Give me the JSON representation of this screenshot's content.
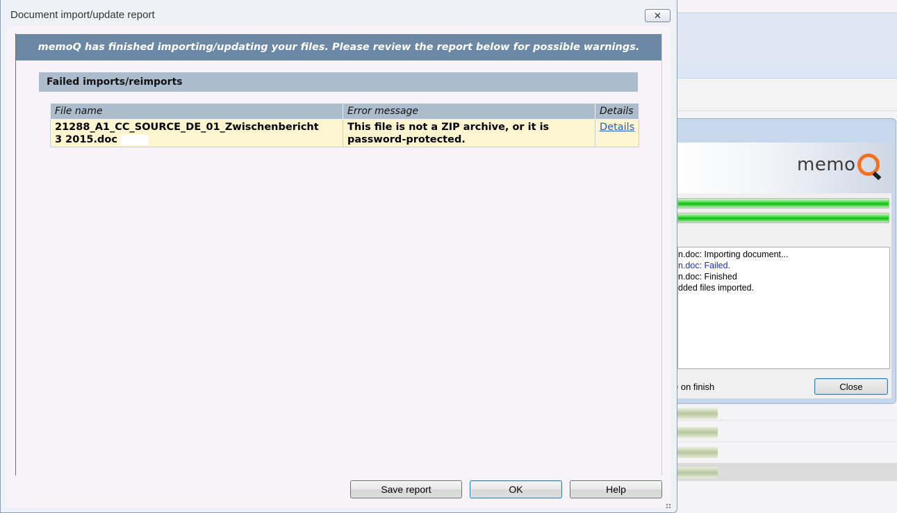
{
  "dialog": {
    "title": "Document import/update report",
    "close_glyph": "✕",
    "banner": "memoQ has finished importing/updating your files. Please review the report below for possible warnings.",
    "section_title": "Failed imports/reimports",
    "table": {
      "columns": [
        "File name",
        "Error message",
        "Details"
      ],
      "rows": [
        {
          "file_name_line1": "21288_A1_CC_SOURCE_DE_01_Zwischenbericht",
          "file_name_line2": "3 2015.doc",
          "error_message": "This file is not a ZIP archive, or it is password-protected.",
          "details": "Details"
        }
      ]
    },
    "buttons": {
      "save_report": "Save report",
      "ok": "OK",
      "help": "Help"
    }
  },
  "background_progress": {
    "logo_text": "memo",
    "log_lines": [
      {
        "text": "n.doc: Importing document...",
        "status": "normal"
      },
      {
        "text": "n.doc: Failed.",
        "status": "failed"
      },
      {
        "text": "n.doc: Finished",
        "status": "normal"
      },
      {
        "text": "dded files imported.",
        "status": "normal"
      }
    ],
    "close_on_finish_label": "e on finish",
    "close_button": "Close"
  },
  "colors": {
    "banner_bg": "#6b89a4",
    "header_bg": "#acbccd",
    "row_bg": "#fcf5cf",
    "link": "#1f5fbf",
    "log_failed": "#1a2ec0",
    "progress_green": "#11b811",
    "logo_accent": "#f37021"
  }
}
